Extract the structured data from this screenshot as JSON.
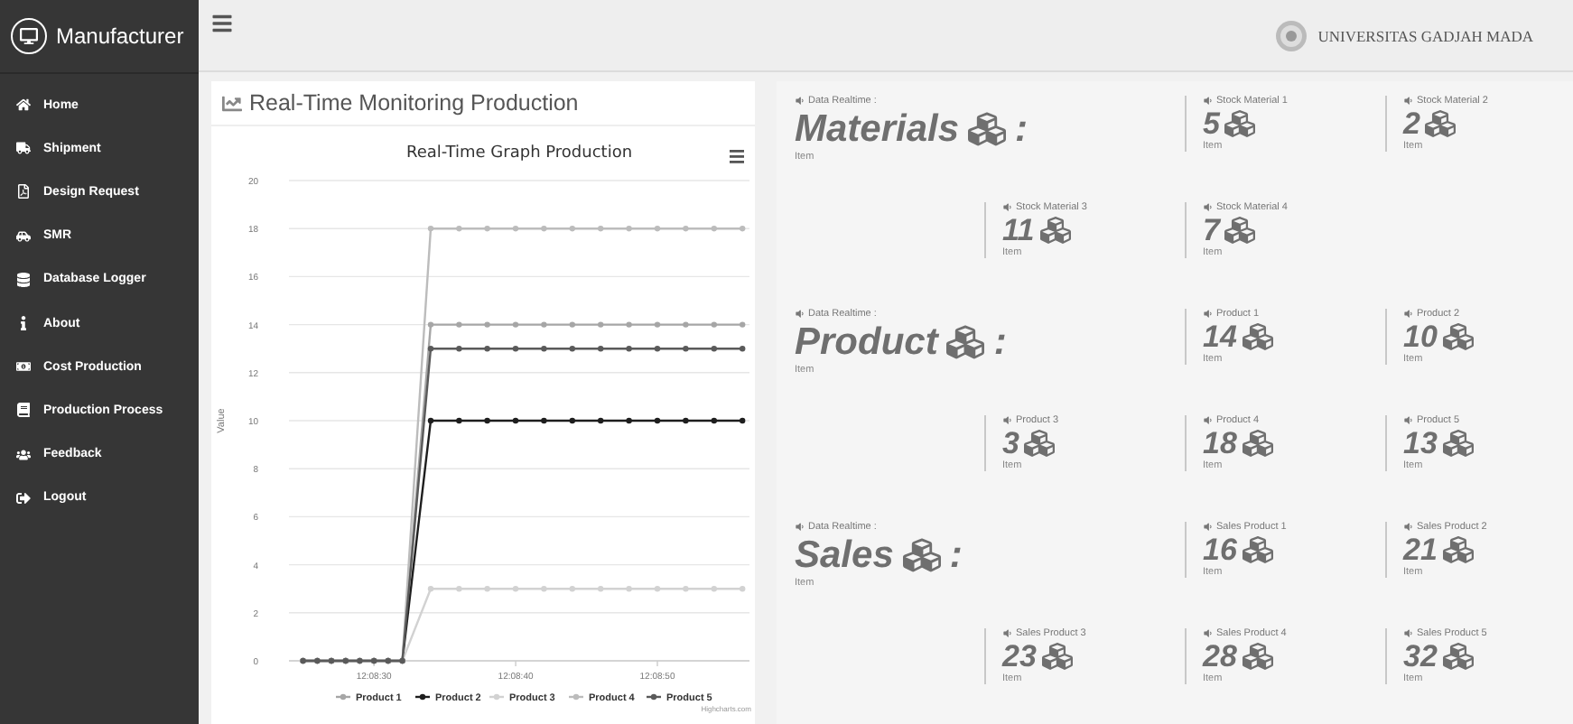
{
  "sidebar": {
    "brand": "Manufacturer",
    "items": [
      {
        "label": "Home"
      },
      {
        "label": "Shipment"
      },
      {
        "label": "Design Request"
      },
      {
        "label": "SMR"
      },
      {
        "label": "Database Logger"
      },
      {
        "label": "About"
      },
      {
        "label": "Cost Production"
      },
      {
        "label": "Production Process"
      },
      {
        "label": "Feedback"
      },
      {
        "label": "Logout"
      }
    ]
  },
  "topbar": {
    "university": "UNIVERSITAS GADJAH MADA"
  },
  "chart_panel": {
    "title": "Real-Time Monitoring Production",
    "credits": "Highcharts.com",
    "chart_data": {
      "type": "line",
      "grid": true,
      "legend": "bottom",
      "title": "Real-Time Graph Production",
      "ylabel": "Value",
      "x": [
        43705,
        43706,
        43707,
        43708,
        43709,
        43710,
        43711,
        43712,
        43714,
        43716,
        43718,
        43720,
        43722,
        43724,
        43726,
        43728,
        43730,
        43732,
        43734,
        43736
      ],
      "xlim": [
        43704,
        43736.5
      ],
      "ylim": [
        0,
        20
      ],
      "xticks": [
        {
          "value": 43710,
          "label": "12:08:30"
        },
        {
          "value": 43720,
          "label": "12:08:40"
        },
        {
          "value": 43730,
          "label": "12:08:50"
        }
      ],
      "yticks": [
        0,
        2,
        4,
        6,
        8,
        10,
        12,
        14,
        16,
        18,
        20
      ],
      "series": [
        {
          "name": "Product 1",
          "color": "#a6a6a6",
          "values": [
            0,
            0,
            0,
            0,
            0,
            0,
            0,
            0,
            14,
            14,
            14,
            14,
            14,
            14,
            14,
            14,
            14,
            14,
            14,
            14
          ]
        },
        {
          "name": "Product 2",
          "color": "#1e1e1e",
          "values": [
            0,
            0,
            0,
            0,
            0,
            0,
            0,
            0,
            10,
            10,
            10,
            10,
            10,
            10,
            10,
            10,
            10,
            10,
            10,
            10
          ]
        },
        {
          "name": "Product 3",
          "color": "#d2d2d2",
          "values": [
            0,
            0,
            0,
            0,
            0,
            0,
            0,
            0,
            3,
            3,
            3,
            3,
            3,
            3,
            3,
            3,
            3,
            3,
            3,
            3
          ]
        },
        {
          "name": "Product 4",
          "color": "#bcbcbc",
          "values": [
            0,
            0,
            0,
            0,
            0,
            0,
            0,
            0,
            18,
            18,
            18,
            18,
            18,
            18,
            18,
            18,
            18,
            18,
            18,
            18
          ]
        },
        {
          "name": "Product 5",
          "color": "#5a5a5a",
          "values": [
            0,
            0,
            0,
            0,
            0,
            0,
            0,
            0,
            13,
            13,
            13,
            13,
            13,
            13,
            13,
            13,
            13,
            13,
            13,
            13
          ]
        }
      ]
    }
  },
  "stats": [
    {
      "caption": "Data Realtime :",
      "title": "Materials",
      "separator": ":",
      "unit": "Item",
      "items": [
        {
          "label": "Stock Material 1",
          "value": "5",
          "unit": "Item"
        },
        {
          "label": "Stock Material 2",
          "value": "2",
          "unit": "Item"
        },
        {
          "label": "Stock Material 3",
          "value": "11",
          "unit": "Item"
        },
        {
          "label": "Stock Material 4",
          "value": "7",
          "unit": "Item"
        }
      ]
    },
    {
      "caption": "Data Realtime :",
      "title": "Product",
      "separator": ":",
      "unit": "Item",
      "items": [
        {
          "label": "Product 1",
          "value": "14",
          "unit": "Item"
        },
        {
          "label": "Product 2",
          "value": "10",
          "unit": "Item"
        },
        {
          "label": "Product 3",
          "value": "3",
          "unit": "Item"
        },
        {
          "label": "Product 4",
          "value": "18",
          "unit": "Item"
        },
        {
          "label": "Product 5",
          "value": "13",
          "unit": "Item"
        }
      ]
    },
    {
      "caption": "Data Realtime :",
      "title": "Sales",
      "separator": ":",
      "unit": "Item",
      "items": [
        {
          "label": "Sales Product 1",
          "value": "16",
          "unit": "Item"
        },
        {
          "label": "Sales Product 2",
          "value": "21",
          "unit": "Item"
        },
        {
          "label": "Sales Product 3",
          "value": "23",
          "unit": "Item"
        },
        {
          "label": "Sales Product 4",
          "value": "28",
          "unit": "Item"
        },
        {
          "label": "Sales Product 5",
          "value": "32",
          "unit": "Item"
        }
      ]
    }
  ]
}
